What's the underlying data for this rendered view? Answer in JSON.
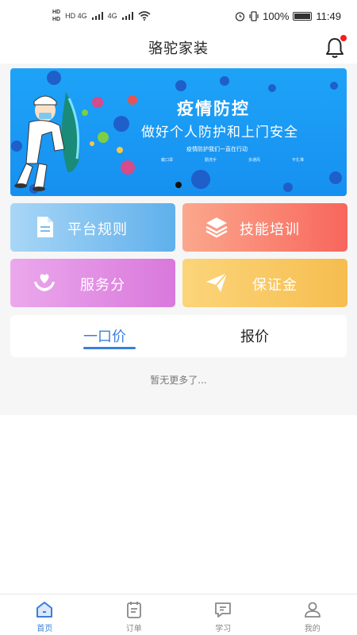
{
  "status_bar": {
    "network_left": "HD 4G",
    "network_right": "4G",
    "battery": "100%",
    "time": "11:49"
  },
  "header": {
    "title": "骆驼家装",
    "bell_icon": "bell-icon",
    "has_notification": true
  },
  "banner": {
    "headline": "疫情防控",
    "subheadline": "做好个人防护和上门安全",
    "caption": "疫情防护我们一直在行动",
    "tips": [
      "戴口罩",
      "勤洗手",
      "多通风",
      "不扎堆"
    ]
  },
  "cards": [
    {
      "label": "平台规则",
      "icon": "document-icon"
    },
    {
      "label": "技能培训",
      "icon": "layers-icon"
    },
    {
      "label": "服务分",
      "icon": "heart-hand-icon"
    },
    {
      "label": "保证金",
      "icon": "paper-plane-icon"
    }
  ],
  "tabs": [
    {
      "label": "一口价",
      "active": true
    },
    {
      "label": "报价",
      "active": false
    }
  ],
  "empty_text": "暂无更多了...",
  "nav": [
    {
      "label": "首页",
      "icon": "home-icon",
      "active": true
    },
    {
      "label": "订单",
      "icon": "clipboard-icon",
      "active": false
    },
    {
      "label": "学习",
      "icon": "chat-icon",
      "active": false
    },
    {
      "label": "我的",
      "icon": "user-icon",
      "active": false
    }
  ],
  "colors": {
    "accent": "#3b7fd9",
    "notification_dot": "#f02020"
  }
}
